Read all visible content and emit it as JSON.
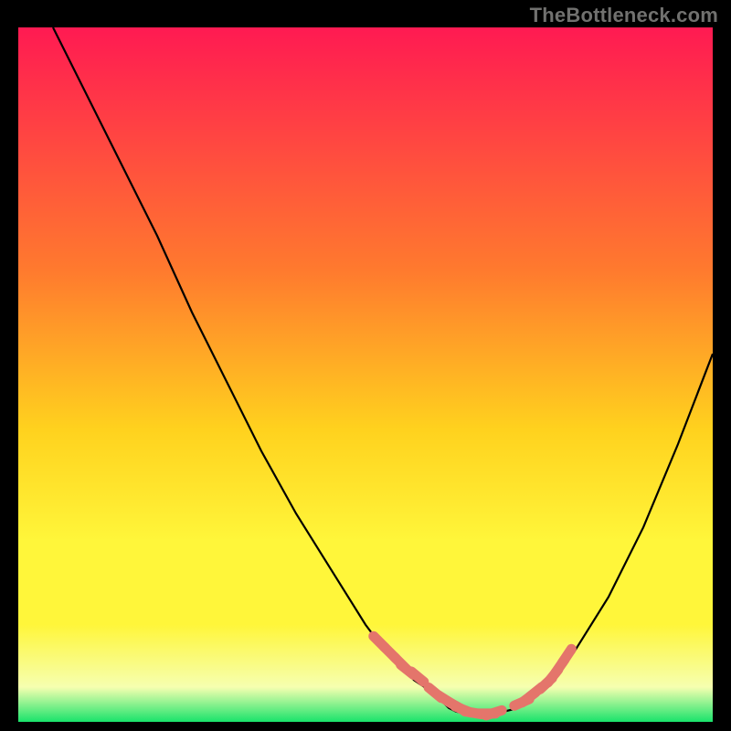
{
  "watermark": "TheBottleneck.com",
  "colors": {
    "bg": "#000000",
    "grad_top": "#ff1a52",
    "grad_mid1": "#ff7a2e",
    "grad_mid2": "#ffd21e",
    "grad_mid3": "#fff63a",
    "grad_pale": "#f6ffb0",
    "grad_bottom": "#19e36b",
    "curve": "#000000",
    "marker": "#e4756b"
  },
  "chart_data": {
    "type": "line",
    "title": "",
    "xlabel": "",
    "ylabel": "",
    "xlim": [
      0,
      100
    ],
    "ylim": [
      0,
      100
    ],
    "series": [
      {
        "name": "bottleneck-curve",
        "x": [
          5,
          10,
          15,
          20,
          25,
          30,
          35,
          40,
          45,
          50,
          53,
          55,
          57,
          60,
          62,
          63,
          65,
          68,
          72,
          76,
          80,
          85,
          90,
          95,
          100
        ],
        "y": [
          100,
          90,
          80,
          70,
          59,
          49,
          39,
          30,
          22,
          14,
          10,
          8,
          6,
          4,
          2,
          1.5,
          1,
          1,
          2,
          5,
          10,
          18,
          28,
          40,
          53
        ]
      }
    ],
    "markers": {
      "name": "highlight-points",
      "x": [
        52,
        53.5,
        55,
        56,
        57.5,
        60,
        61.5,
        63,
        64,
        65.5,
        67.5,
        68.5,
        72.5,
        73.5,
        74.5,
        76,
        77,
        78,
        79
      ],
      "y": [
        11.5,
        10,
        8.5,
        7.5,
        6.5,
        4.2,
        3.2,
        2.3,
        1.8,
        1.3,
        1.2,
        1.3,
        2.8,
        3.5,
        4.3,
        5.5,
        6.6,
        8,
        9.5
      ]
    }
  }
}
